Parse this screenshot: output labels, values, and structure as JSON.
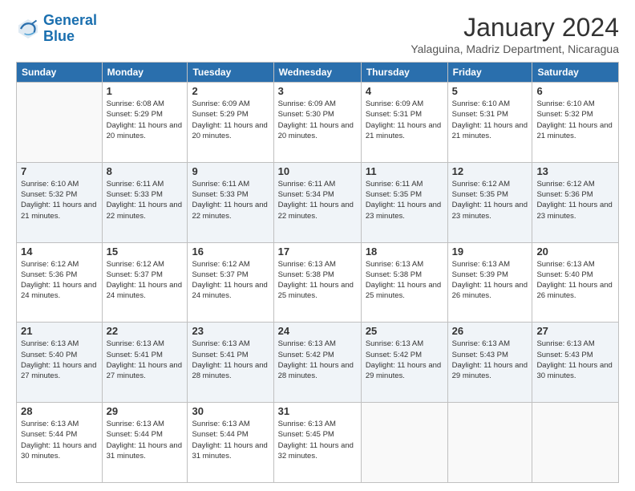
{
  "logo": {
    "line1": "General",
    "line2": "Blue"
  },
  "header": {
    "month": "January 2024",
    "location": "Yalaguina, Madriz Department, Nicaragua"
  },
  "weekdays": [
    "Sunday",
    "Monday",
    "Tuesday",
    "Wednesday",
    "Thursday",
    "Friday",
    "Saturday"
  ],
  "weeks": [
    [
      {
        "day": "",
        "sunrise": "",
        "sunset": "",
        "daylight": ""
      },
      {
        "day": "1",
        "sunrise": "Sunrise: 6:08 AM",
        "sunset": "Sunset: 5:29 PM",
        "daylight": "Daylight: 11 hours and 20 minutes."
      },
      {
        "day": "2",
        "sunrise": "Sunrise: 6:09 AM",
        "sunset": "Sunset: 5:29 PM",
        "daylight": "Daylight: 11 hours and 20 minutes."
      },
      {
        "day": "3",
        "sunrise": "Sunrise: 6:09 AM",
        "sunset": "Sunset: 5:30 PM",
        "daylight": "Daylight: 11 hours and 20 minutes."
      },
      {
        "day": "4",
        "sunrise": "Sunrise: 6:09 AM",
        "sunset": "Sunset: 5:31 PM",
        "daylight": "Daylight: 11 hours and 21 minutes."
      },
      {
        "day": "5",
        "sunrise": "Sunrise: 6:10 AM",
        "sunset": "Sunset: 5:31 PM",
        "daylight": "Daylight: 11 hours and 21 minutes."
      },
      {
        "day": "6",
        "sunrise": "Sunrise: 6:10 AM",
        "sunset": "Sunset: 5:32 PM",
        "daylight": "Daylight: 11 hours and 21 minutes."
      }
    ],
    [
      {
        "day": "7",
        "sunrise": "Sunrise: 6:10 AM",
        "sunset": "Sunset: 5:32 PM",
        "daylight": "Daylight: 11 hours and 21 minutes."
      },
      {
        "day": "8",
        "sunrise": "Sunrise: 6:11 AM",
        "sunset": "Sunset: 5:33 PM",
        "daylight": "Daylight: 11 hours and 22 minutes."
      },
      {
        "day": "9",
        "sunrise": "Sunrise: 6:11 AM",
        "sunset": "Sunset: 5:33 PM",
        "daylight": "Daylight: 11 hours and 22 minutes."
      },
      {
        "day": "10",
        "sunrise": "Sunrise: 6:11 AM",
        "sunset": "Sunset: 5:34 PM",
        "daylight": "Daylight: 11 hours and 22 minutes."
      },
      {
        "day": "11",
        "sunrise": "Sunrise: 6:11 AM",
        "sunset": "Sunset: 5:35 PM",
        "daylight": "Daylight: 11 hours and 23 minutes."
      },
      {
        "day": "12",
        "sunrise": "Sunrise: 6:12 AM",
        "sunset": "Sunset: 5:35 PM",
        "daylight": "Daylight: 11 hours and 23 minutes."
      },
      {
        "day": "13",
        "sunrise": "Sunrise: 6:12 AM",
        "sunset": "Sunset: 5:36 PM",
        "daylight": "Daylight: 11 hours and 23 minutes."
      }
    ],
    [
      {
        "day": "14",
        "sunrise": "Sunrise: 6:12 AM",
        "sunset": "Sunset: 5:36 PM",
        "daylight": "Daylight: 11 hours and 24 minutes."
      },
      {
        "day": "15",
        "sunrise": "Sunrise: 6:12 AM",
        "sunset": "Sunset: 5:37 PM",
        "daylight": "Daylight: 11 hours and 24 minutes."
      },
      {
        "day": "16",
        "sunrise": "Sunrise: 6:12 AM",
        "sunset": "Sunset: 5:37 PM",
        "daylight": "Daylight: 11 hours and 24 minutes."
      },
      {
        "day": "17",
        "sunrise": "Sunrise: 6:13 AM",
        "sunset": "Sunset: 5:38 PM",
        "daylight": "Daylight: 11 hours and 25 minutes."
      },
      {
        "day": "18",
        "sunrise": "Sunrise: 6:13 AM",
        "sunset": "Sunset: 5:38 PM",
        "daylight": "Daylight: 11 hours and 25 minutes."
      },
      {
        "day": "19",
        "sunrise": "Sunrise: 6:13 AM",
        "sunset": "Sunset: 5:39 PM",
        "daylight": "Daylight: 11 hours and 26 minutes."
      },
      {
        "day": "20",
        "sunrise": "Sunrise: 6:13 AM",
        "sunset": "Sunset: 5:40 PM",
        "daylight": "Daylight: 11 hours and 26 minutes."
      }
    ],
    [
      {
        "day": "21",
        "sunrise": "Sunrise: 6:13 AM",
        "sunset": "Sunset: 5:40 PM",
        "daylight": "Daylight: 11 hours and 27 minutes."
      },
      {
        "day": "22",
        "sunrise": "Sunrise: 6:13 AM",
        "sunset": "Sunset: 5:41 PM",
        "daylight": "Daylight: 11 hours and 27 minutes."
      },
      {
        "day": "23",
        "sunrise": "Sunrise: 6:13 AM",
        "sunset": "Sunset: 5:41 PM",
        "daylight": "Daylight: 11 hours and 28 minutes."
      },
      {
        "day": "24",
        "sunrise": "Sunrise: 6:13 AM",
        "sunset": "Sunset: 5:42 PM",
        "daylight": "Daylight: 11 hours and 28 minutes."
      },
      {
        "day": "25",
        "sunrise": "Sunrise: 6:13 AM",
        "sunset": "Sunset: 5:42 PM",
        "daylight": "Daylight: 11 hours and 29 minutes."
      },
      {
        "day": "26",
        "sunrise": "Sunrise: 6:13 AM",
        "sunset": "Sunset: 5:43 PM",
        "daylight": "Daylight: 11 hours and 29 minutes."
      },
      {
        "day": "27",
        "sunrise": "Sunrise: 6:13 AM",
        "sunset": "Sunset: 5:43 PM",
        "daylight": "Daylight: 11 hours and 30 minutes."
      }
    ],
    [
      {
        "day": "28",
        "sunrise": "Sunrise: 6:13 AM",
        "sunset": "Sunset: 5:44 PM",
        "daylight": "Daylight: 11 hours and 30 minutes."
      },
      {
        "day": "29",
        "sunrise": "Sunrise: 6:13 AM",
        "sunset": "Sunset: 5:44 PM",
        "daylight": "Daylight: 11 hours and 31 minutes."
      },
      {
        "day": "30",
        "sunrise": "Sunrise: 6:13 AM",
        "sunset": "Sunset: 5:44 PM",
        "daylight": "Daylight: 11 hours and 31 minutes."
      },
      {
        "day": "31",
        "sunrise": "Sunrise: 6:13 AM",
        "sunset": "Sunset: 5:45 PM",
        "daylight": "Daylight: 11 hours and 32 minutes."
      },
      {
        "day": "",
        "sunrise": "",
        "sunset": "",
        "daylight": ""
      },
      {
        "day": "",
        "sunrise": "",
        "sunset": "",
        "daylight": ""
      },
      {
        "day": "",
        "sunrise": "",
        "sunset": "",
        "daylight": ""
      }
    ]
  ]
}
